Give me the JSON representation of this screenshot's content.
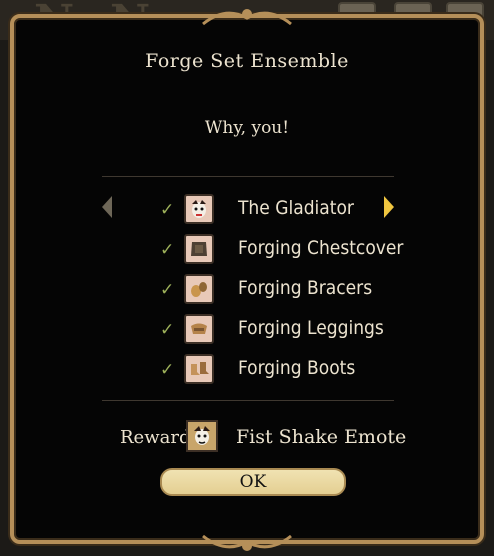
{
  "dialog": {
    "title": "Forge Set Ensemble",
    "subtitle": "Why, you!"
  },
  "items": [
    {
      "name": "The Gladiator",
      "checked": true,
      "icon": "gladiator-portrait-icon"
    },
    {
      "name": "Forging Chestcover",
      "checked": true,
      "icon": "chestcover-icon"
    },
    {
      "name": "Forging Bracers",
      "checked": true,
      "icon": "bracers-icon"
    },
    {
      "name": "Forging Leggings",
      "checked": true,
      "icon": "leggings-icon"
    },
    {
      "name": "Forging Boots",
      "checked": true,
      "icon": "boots-icon"
    }
  ],
  "reward": {
    "label": "Reward:",
    "name": "Fist Shake Emote",
    "icon": "fist-shake-emote-icon"
  },
  "ok_button": {
    "label": "OK"
  },
  "colors": {
    "frame": "#b58f59",
    "text": "#ece3cf",
    "check": "#9db05a",
    "button": "#e8d7a0"
  }
}
